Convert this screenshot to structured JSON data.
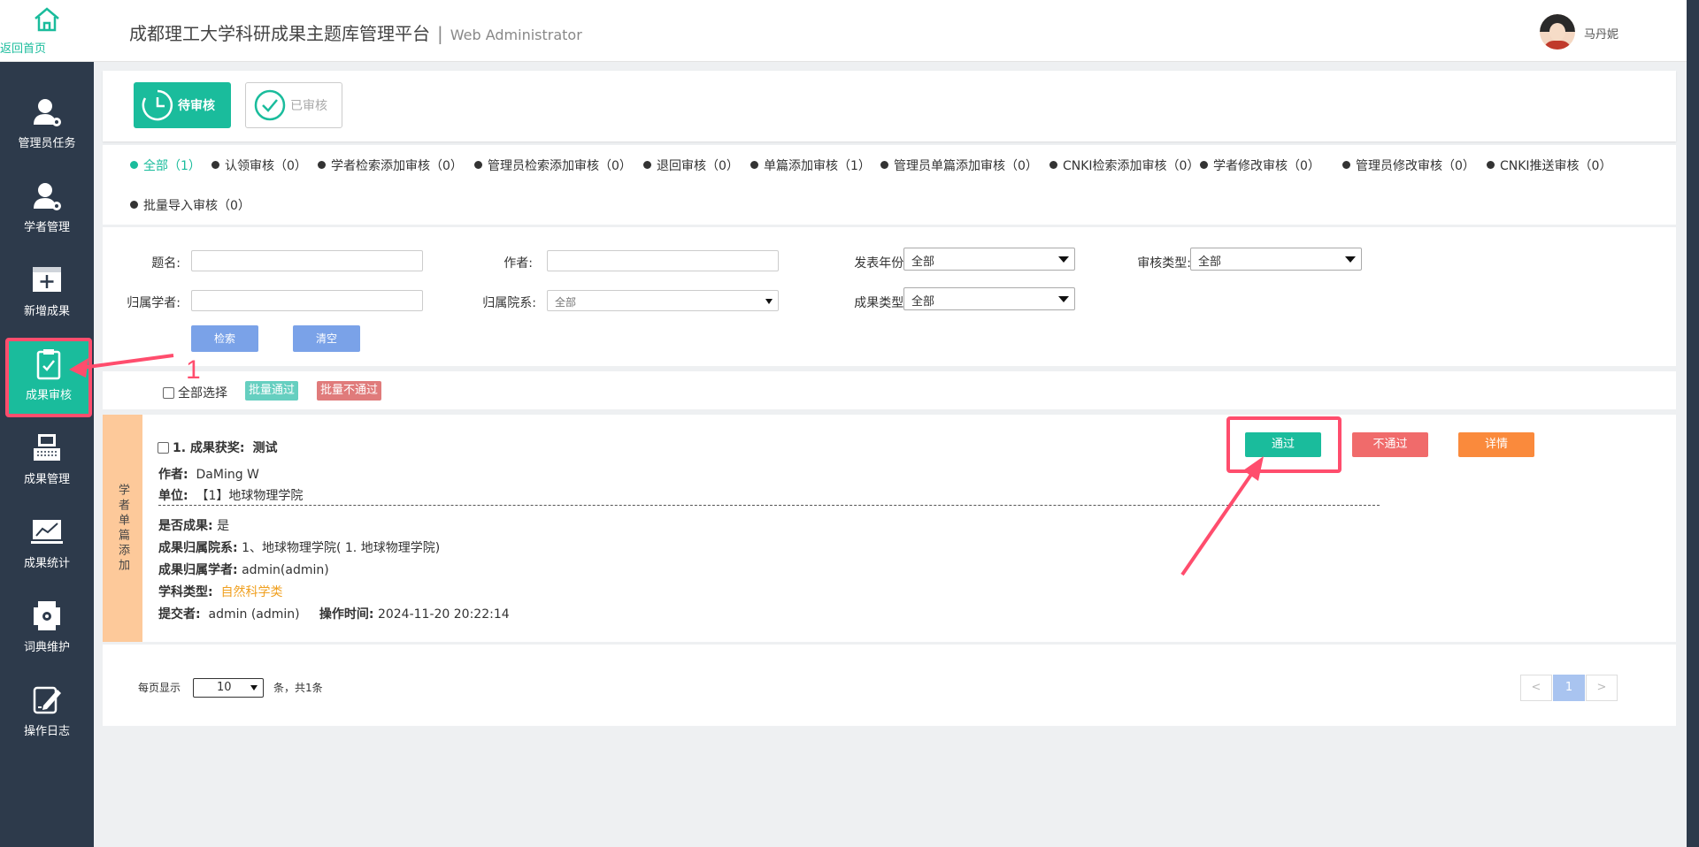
{
  "sidebar": {
    "home_label": "返回首页",
    "items": [
      {
        "label": "管理员任务",
        "icon": "admin-task-icon"
      },
      {
        "label": "学者管理",
        "icon": "scholar-manage-icon"
      },
      {
        "label": "新增成果",
        "icon": "add-result-icon"
      },
      {
        "label": "成果审核",
        "icon": "clipboard-check-icon",
        "active": true
      },
      {
        "label": "成果管理",
        "icon": "keyboard-icon"
      },
      {
        "label": "成果统计",
        "icon": "chart-icon"
      },
      {
        "label": "词典维护",
        "icon": "dictionary-icon"
      },
      {
        "label": "操作日志",
        "icon": "edit-log-icon"
      }
    ]
  },
  "header": {
    "title": "成都理工大学科研成果主题库管理平台",
    "separator": "|",
    "subtitle": "Web Administrator",
    "username": "马丹妮"
  },
  "status_tabs": {
    "pending": "待审核",
    "done": "已审核"
  },
  "filter_tabs": [
    "全部（1）",
    "认领审核（0）",
    "学者检索添加审核（0）",
    "管理员检索添加审核（0）",
    "退回审核（0）",
    "单篇添加审核（1）",
    "管理员单篇添加审核（0）",
    "CNKI检索添加审核（0）",
    "学者修改审核（0）",
    "管理员修改审核（0）",
    "CNKI推送审核（0）",
    "批量导入审核（0）"
  ],
  "search": {
    "title_label": "题名:",
    "author_label": "作者:",
    "year_label": "发表年份:",
    "year_value": "全部",
    "audit_type_label": "审核类型:",
    "audit_type_value": "全部",
    "scholar_label": "归属学者:",
    "dept_label": "归属院系:",
    "dept_value": "全部",
    "result_type_label": "成果类型:",
    "result_type_value": "全部",
    "search_btn": "检索",
    "clear_btn": "清空"
  },
  "batch": {
    "select_all": "全部选择",
    "approve_all": "批量通过",
    "reject_all": "批量不通过"
  },
  "record": {
    "side_tag": "学者单篇添加",
    "title_prefix": "1. 成果获奖:",
    "title": "测试",
    "author_label": "作者:",
    "author": "DaMing W",
    "unit_label": "单位:",
    "unit": "【1】地球物理学院",
    "is_result_label": "是否成果:",
    "is_result": "是",
    "dept_label": "成果归属院系:",
    "dept": "1、地球物理学院( 1. 地球物理学院)",
    "scholar_label": "成果归属学者:",
    "scholar": "admin(admin)",
    "subject_label": "学科类型:",
    "subject": "自然科学类",
    "submitter_label": "提交者:",
    "submitter": "admin (admin)",
    "op_time_label": "操作时间:",
    "op_time": "2024-11-20 20:22:14",
    "approve_btn": "通过",
    "reject_btn": "不通过",
    "detail_btn": "详情"
  },
  "pagination": {
    "per_page_label": "每页显示",
    "per_page_value": "10",
    "total_text": "条，共1条",
    "prev": "<",
    "current": "1",
    "next": ">"
  },
  "annotations": {
    "step_number": "1"
  },
  "colors": {
    "accent": "#1abc9c",
    "sidebar": "#2d3a4b",
    "danger": "#f06b6b",
    "warning": "#fa8a3c",
    "highlight": "#ff4d6d"
  }
}
